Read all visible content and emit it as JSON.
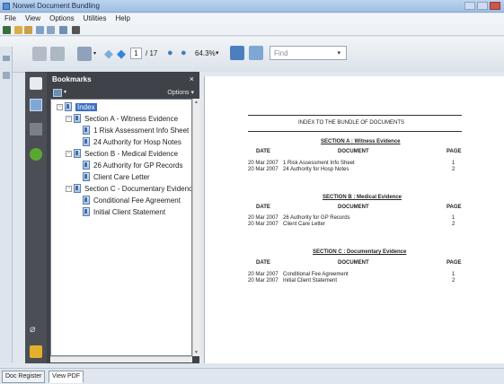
{
  "window": {
    "title": "Norwel Document Bundling"
  },
  "menu": [
    "File",
    "View",
    "Options",
    "Utilities",
    "Help"
  ],
  "reader_toolbar": {
    "page_current": "1",
    "page_total": "/ 17",
    "zoom": "64.3%",
    "find_placeholder": "Find"
  },
  "bookmarks": {
    "title": "Bookmarks",
    "close": "×",
    "options": "Options ▾",
    "tree": [
      {
        "label": "Index"
      },
      {
        "label": "Section A - Witness Evidence"
      },
      {
        "label": "1  Risk Assessment Info Sheet"
      },
      {
        "label": "24  Authority for Hosp Notes"
      },
      {
        "label": "Section B - Medical Evidence"
      },
      {
        "label": "26  Authority for GP Records"
      },
      {
        "label": "Client Care Letter"
      },
      {
        "label": "Section C - Documentary Evidence"
      },
      {
        "label": "Conditional Fee Agreement"
      },
      {
        "label": "Initial Client Statement"
      }
    ]
  },
  "document": {
    "heading": "INDEX TO THE BUNDLE OF DOCUMENTS",
    "col_date": "DATE",
    "col_document": "DOCUMENT",
    "col_page": "PAGE",
    "sections": [
      {
        "title": "SECTION A : Witness Evidence",
        "rows": [
          {
            "date": "20 Mar 2007",
            "doc": "1  Risk Assessment Info Sheet",
            "page": "1"
          },
          {
            "date": "20 Mar 2007",
            "doc": "24  Authority for Hosp Notes",
            "page": "2"
          }
        ]
      },
      {
        "title": "SECTION B : Medical Evidence",
        "rows": [
          {
            "date": "20 Mar 2007",
            "doc": "26  Authority for GP Records",
            "page": "1"
          },
          {
            "date": "20 Mar 2007",
            "doc": "Client Care Letter",
            "page": "2"
          }
        ]
      },
      {
        "title": "SECTION C : Documentary Evidence",
        "rows": [
          {
            "date": "20 Mar 2007",
            "doc": "Conditional Fee Agreement",
            "page": "1"
          },
          {
            "date": "20 Mar 2007",
            "doc": "Initial Client Statement",
            "page": "2"
          }
        ]
      }
    ]
  },
  "tabs": [
    "Doc Register",
    "View PDF"
  ],
  "colors": {
    "titlebar": "#9fbfe3",
    "panel_dark": "#3f4349",
    "selection": "#3d6fc0"
  }
}
